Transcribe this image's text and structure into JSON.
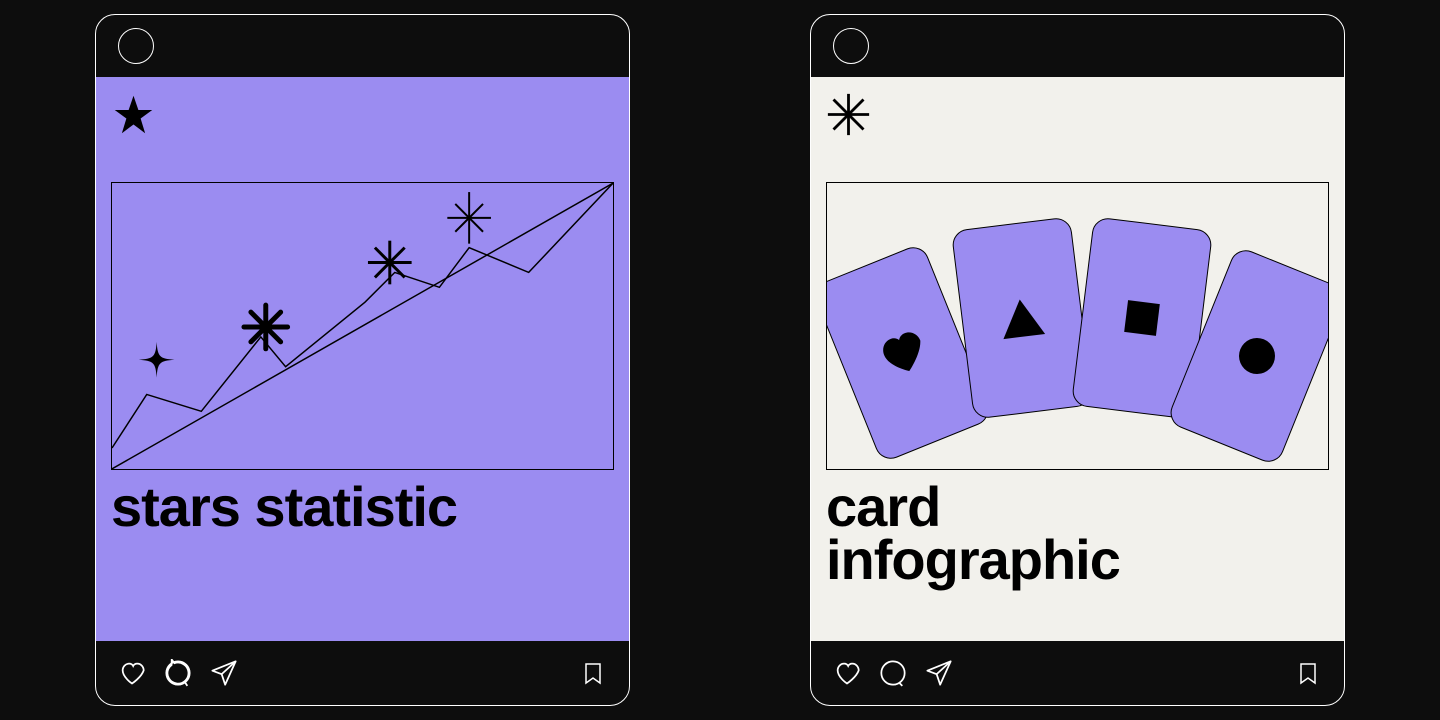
{
  "posts": [
    {
      "title": "stars statistic",
      "corner_icon": "star-icon",
      "bg": "purple"
    },
    {
      "title": "card infographic",
      "corner_icon": "sparkle-icon",
      "bg": "cream"
    }
  ],
  "colors": {
    "purple": "#9b8cf1",
    "cream": "#f2f1ec",
    "dark": "#0d0d0d"
  }
}
